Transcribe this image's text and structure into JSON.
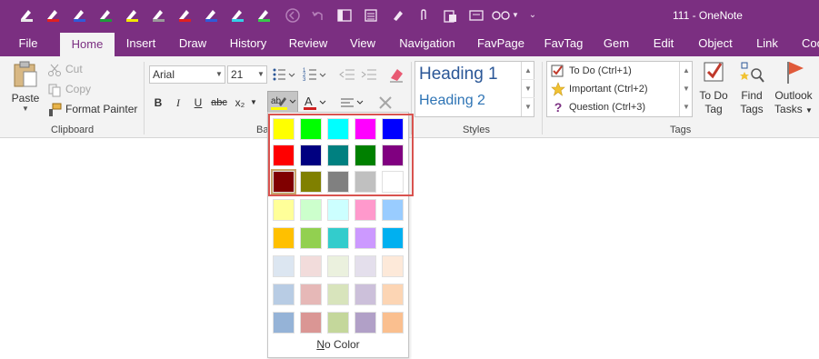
{
  "window": {
    "title": "111 - OneNote"
  },
  "qat": {
    "pens": [
      {
        "color": "#e8e8e8"
      },
      {
        "color": "#e02020"
      },
      {
        "color": "#2f5bd8"
      },
      {
        "color": "#1e9b3a"
      },
      {
        "color": "#f2e600"
      },
      {
        "color": "#9a9a9a"
      },
      {
        "color": "#e02020"
      },
      {
        "color": "#2f5bd8"
      },
      {
        "color": "#34d0e8"
      },
      {
        "color": "#38c84a"
      }
    ],
    "icons": [
      "back-icon",
      "undo-icon",
      "dock-icon",
      "page-icon",
      "touch-icon",
      "attach-icon",
      "paste-icon",
      "screen-icon",
      "glasses-icon",
      "customize-icon"
    ]
  },
  "tabs": [
    "File",
    "Home",
    "Insert",
    "Draw",
    "History",
    "Review",
    "View",
    "Navigation",
    "FavPage",
    "FavTag",
    "Gem",
    "Edit",
    "Object",
    "Link",
    "Coo"
  ],
  "clipboard": {
    "paste": "Paste",
    "cut": "Cut",
    "copy": "Copy",
    "format_painter": "Format Painter",
    "label": "Clipboard"
  },
  "basic_text": {
    "font": "Arial",
    "size": "21",
    "bold": "B",
    "italic": "I",
    "underline": "U",
    "strike": "abc",
    "subscript": "x₂",
    "label": "Bas"
  },
  "styles": {
    "heading1": "Heading 1",
    "heading2": "Heading 2",
    "label": "Styles"
  },
  "tags": {
    "todo": "To Do (Ctrl+1)",
    "important": "Important (Ctrl+2)",
    "question": "Question (Ctrl+3)",
    "todo_tag": [
      "To Do",
      "Tag"
    ],
    "find_tags": [
      "Find",
      "Tags"
    ],
    "outlook_tasks": [
      "Outlook",
      "Tasks"
    ],
    "label": "Tags"
  },
  "color_dropdown": {
    "standard": [
      [
        "#ffff00",
        "#00ff00",
        "#00ffff",
        "#ff00ff",
        "#0000ff"
      ],
      [
        "#ff0000",
        "#000080",
        "#008080",
        "#008000",
        "#800080"
      ],
      [
        "#800000",
        "#808000",
        "#808080",
        "#c0c0c0",
        "#ffffff"
      ]
    ],
    "theme": [
      [
        "#ffff99",
        "#ccffcc",
        "#ccffff",
        "#ff99cc",
        "#99ccff"
      ],
      [
        "#ffc000",
        "#92d050",
        "#33cccc",
        "#cc99ff",
        "#00b0f0"
      ],
      [
        "#dce6f1",
        "#f2dcdb",
        "#ebf1de",
        "#e4dfec",
        "#fde9d9"
      ],
      [
        "#b8cce4",
        "#e6b8b7",
        "#d8e4bc",
        "#ccc0da",
        "#fcd5b4"
      ],
      [
        "#95b3d7",
        "#da9694",
        "#c4d79b",
        "#b1a0c7",
        "#fabf8f"
      ]
    ],
    "no_color_first": "N",
    "no_color_rest": "o Color"
  }
}
